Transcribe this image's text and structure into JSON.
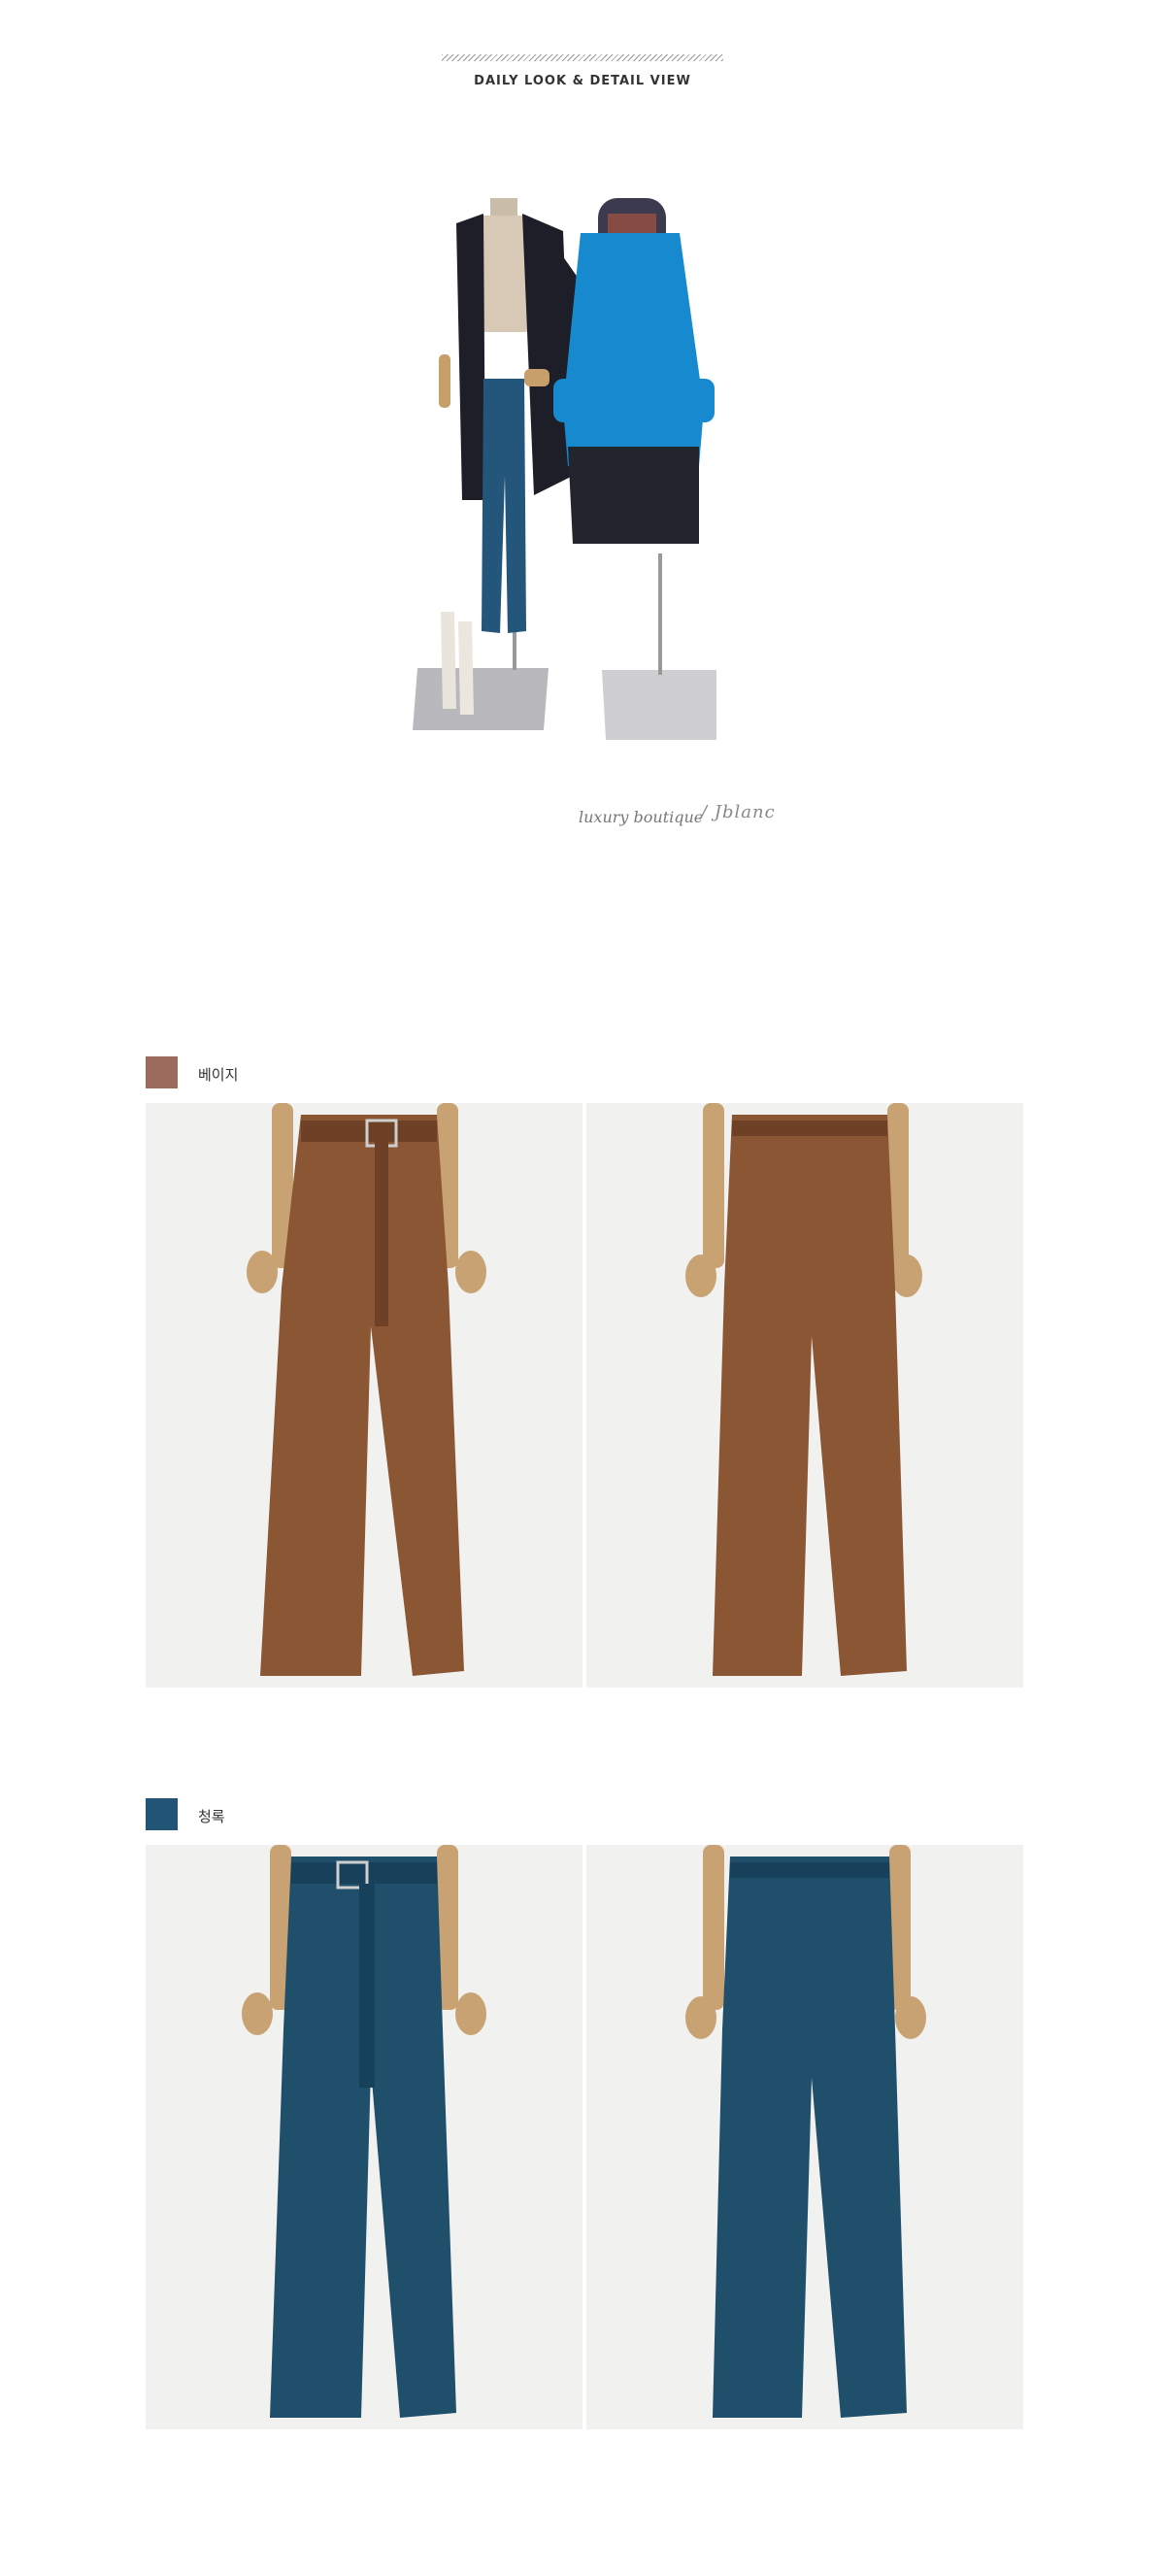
{
  "header": {
    "title": "DAILY LOOK & DETAIL VIEW"
  },
  "brand": {
    "text": "luxury boutique",
    "signature": "/ Jblanc"
  },
  "colors_section": [
    {
      "label": "베이지",
      "swatch_color": "#9b6b5e",
      "garment_color": "#8a5634"
    },
    {
      "label": "청록",
      "swatch_color": "#225575",
      "garment_color": "#1f4f6a"
    }
  ],
  "icons": [
    "mannequin-look-image",
    "pants-front-image",
    "pants-back-image"
  ]
}
